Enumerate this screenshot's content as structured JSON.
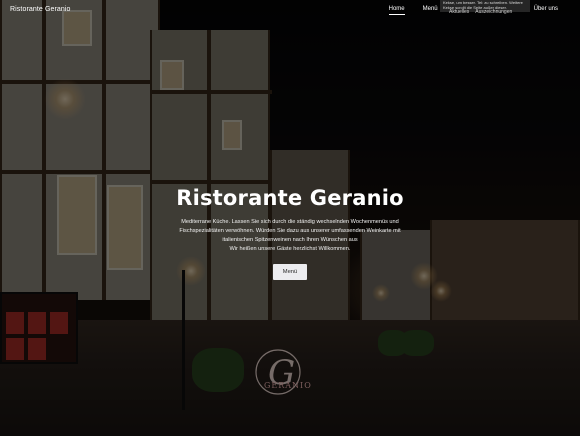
{
  "header": {
    "brand": "Ristorante Geranio",
    "nav": [
      {
        "label": "Home",
        "active": true
      },
      {
        "label": "Menü",
        "active": false
      },
      {
        "label": "Über uns",
        "active": false
      }
    ],
    "tooltip_text": "Kekse, um besser. Tel: zu schreiben. Weitere Kekse scrollt die Seite außer dieser.",
    "hidden_nav": [
      "Aktuelles",
      "Auszeichnungen"
    ]
  },
  "hero": {
    "title": "Ristorante Geranio",
    "text_lines": [
      "Mediterrane Küche. Lassen Sie sich durch die ständig wechselnden Wochenmenüs und",
      "Fischspezialitäten verwöhnen. Würden Sie dazu aus unserer umfassenden Weinkarte mit",
      "italienischen Spitzenweinen nach Ihren Wünschen aus",
      "Wir heißen unsere Gäste herzlichst Willkommen."
    ],
    "button_label": "Menü"
  },
  "watermark": {
    "logo_text": "GERANIO",
    "logo_initial": "G"
  },
  "colors": {
    "overlay": "#000000",
    "button_bg": "#ececef",
    "text": "#ffffff"
  }
}
